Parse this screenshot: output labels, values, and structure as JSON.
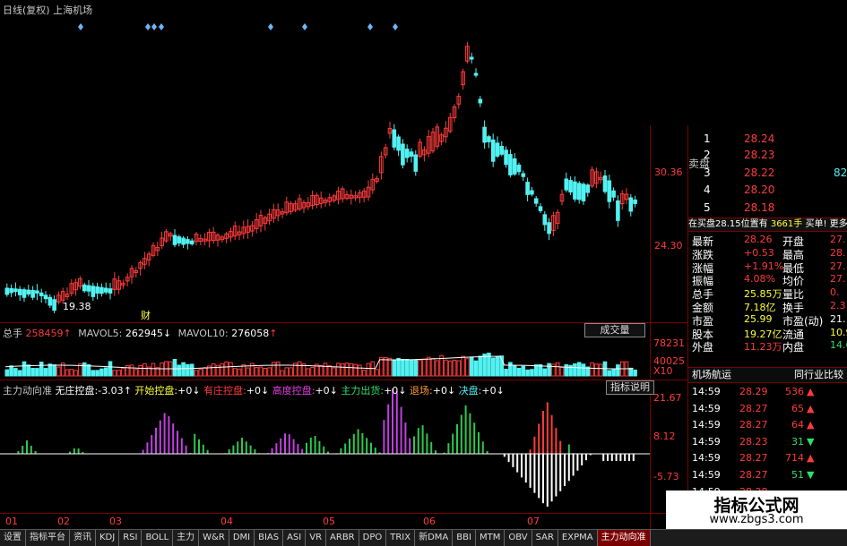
{
  "header": {
    "title": "日线(复权)",
    "market": "上海机场"
  },
  "price_axis": {
    "labels": [
      "30.36",
      "24.30"
    ]
  },
  "price_chart": {
    "high_label": "",
    "low_label": "19.38",
    "event_mark": "财"
  },
  "volume": {
    "total_label": "总手",
    "total": "258459",
    "mavol5_label": "MAVOL5:",
    "mavol5": "262945",
    "mavol10_label": "MAVOL10:",
    "mavol10": "276058",
    "button": "成交量",
    "axis": [
      "78231",
      "40025",
      "X10"
    ]
  },
  "indicator": {
    "name": "主力动向准",
    "items": [
      {
        "label": "无庄控盘:",
        "value": "-3.03"
      },
      {
        "label": "开始控盘:",
        "value": "+0"
      },
      {
        "label": "有庄控盘:",
        "value": "+0"
      },
      {
        "label": "高度控盘:",
        "value": "+0"
      },
      {
        "label": "主力出货:",
        "value": "+0"
      },
      {
        "label": "退场:",
        "value": "+0"
      },
      {
        "label": "决盘:",
        "value": "+0"
      }
    ],
    "button": "指标说明",
    "axis": [
      "21.67",
      "8.12",
      "-5.73"
    ]
  },
  "months": [
    "01",
    "02",
    "03",
    "04",
    "05",
    "06",
    "07"
  ],
  "order_book": {
    "side_label": "卖盘",
    "sell": [
      {
        "lvl": "1",
        "price": "28.24",
        "vol": ""
      },
      {
        "lvl": "2",
        "price": "28.23",
        "vol": ""
      },
      {
        "lvl": "3",
        "price": "28.22",
        "vol": "82"
      },
      {
        "lvl": "4",
        "price": "28.20",
        "vol": ""
      },
      {
        "lvl": "5",
        "price": "28.18",
        "vol": ""
      }
    ],
    "bar": [
      "在买盘28.15位置有",
      "3661手",
      "买单!",
      "更多详"
    ]
  },
  "quote": [
    {
      "k1": "最新",
      "v1": "28.26",
      "k2": "开盘",
      "v2": "27."
    },
    {
      "k1": "涨跌",
      "v1": "+0.53",
      "k2": "最高",
      "v2": "28."
    },
    {
      "k1": "涨幅",
      "v1": "+1.91%",
      "k2": "最低",
      "v2": "27."
    },
    {
      "k1": "振幅",
      "v1": "4.08%",
      "k2": "均价",
      "v2": "27."
    },
    {
      "k1": "总手",
      "v1": "25.85万",
      "k2": "量比",
      "v2": "0."
    },
    {
      "k1": "金额",
      "v1": "7.18亿",
      "k2": "换手",
      "v2": "2.3"
    },
    {
      "k1": "市盈",
      "v1": "25.99",
      "k2": "市盈(动)",
      "v2": "21."
    },
    {
      "k1": "股本",
      "v1": "19.27亿",
      "k2": "流通",
      "v2": "10.9"
    },
    {
      "k1": "外盘",
      "v1": "11.23万",
      "k2": "内盘",
      "v2": "14.6"
    }
  ],
  "ticks_header": {
    "left": "机场航运",
    "right": "同行业比较"
  },
  "ticks": [
    {
      "time": "14:59",
      "price": "28.29",
      "vol": "536",
      "dir": "up"
    },
    {
      "time": "14:59",
      "price": "28.27",
      "vol": "65",
      "dir": "up"
    },
    {
      "time": "14:59",
      "price": "28.27",
      "vol": "64",
      "dir": "up"
    },
    {
      "time": "14:59",
      "price": "28.23",
      "vol": "31",
      "dir": "down"
    },
    {
      "time": "14:59",
      "price": "28.27",
      "vol": "714",
      "dir": "up"
    },
    {
      "time": "14:59",
      "price": "28.27",
      "vol": "51",
      "dir": "down"
    },
    {
      "time": "14:59",
      "price": "28.28",
      "vol": "",
      "dir": ""
    }
  ],
  "tabs": [
    "设置",
    "指标平台",
    "资讯",
    "KDJ",
    "RSI",
    "BOLL",
    "主力",
    "W&R",
    "DMI",
    "BIAS",
    "ASI",
    "VR",
    "ARBR",
    "DPO",
    "TRIX",
    "新DMA",
    "BBI",
    "MTM",
    "OBV",
    "SAR",
    "EXPMA",
    "主力动向准"
  ],
  "watermark": {
    "title": "指标公式网",
    "url": "www.zbgs3.com"
  },
  "colors": {
    "up": "#ff3b3b",
    "down": "#52f2f2",
    "bg": "#000000",
    "grid": "#7a0000",
    "purple": "#c040e0",
    "green": "#2ec850",
    "white": "#ffffff"
  }
}
